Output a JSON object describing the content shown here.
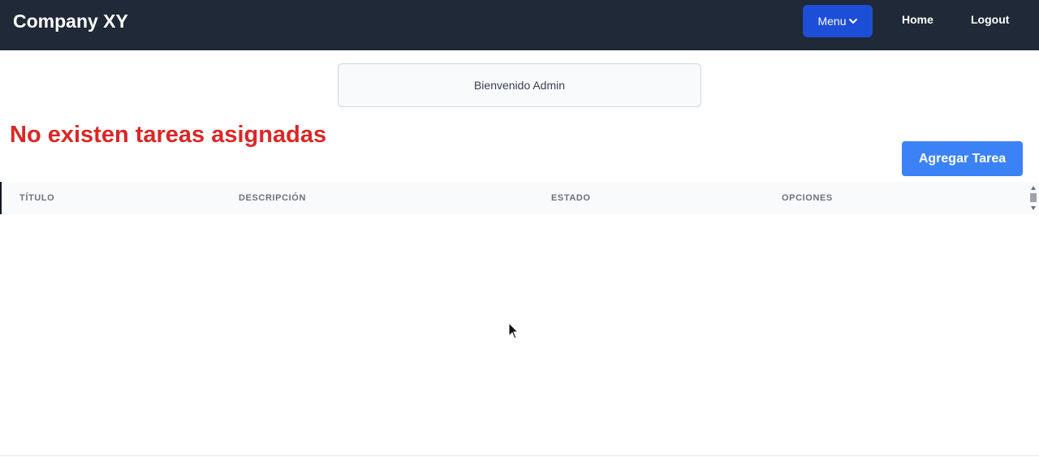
{
  "navbar": {
    "brand": "Company XY",
    "menu_label": "Menu",
    "menu_icon": "chevron-down-icon",
    "links": {
      "home": "Home",
      "logout": "Logout"
    }
  },
  "welcome": {
    "text": "Bienvenido Admin"
  },
  "tasks": {
    "empty_message": "No existen tareas asignadas",
    "add_button": "Agregar Tarea"
  },
  "table": {
    "columns": [
      "TÍTULO",
      "DESCRIPCIÓN",
      "ESTADO",
      "OPCIONES"
    ],
    "rows": []
  },
  "colors": {
    "navbar_bg": "#1f2937",
    "menu_button": "#1d4ed8",
    "add_button": "#3b82f6",
    "empty_message": "#dc2626"
  }
}
